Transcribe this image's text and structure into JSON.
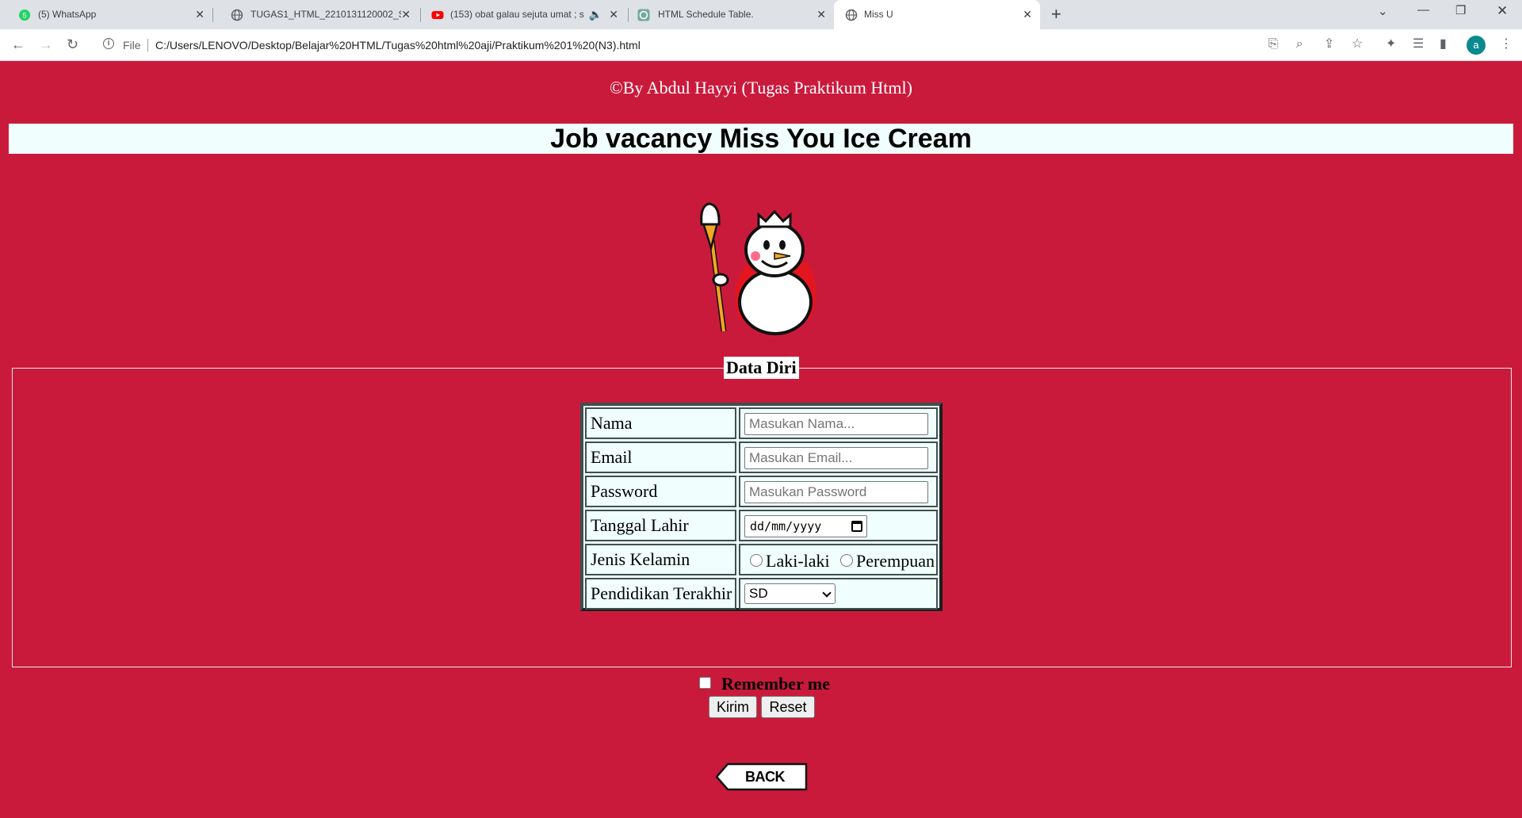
{
  "browser": {
    "tabs": [
      {
        "title": "(5) WhatsApp",
        "icon": "whatsapp-icon"
      },
      {
        "title": "TUGAS1_HTML_2210131120002_SIT",
        "icon": "globe-icon"
      },
      {
        "title": "(153) obat galau sejuta umat ; s",
        "icon": "youtube-icon"
      },
      {
        "title": "HTML Schedule Table.",
        "icon": "chatgpt-icon"
      },
      {
        "title": "Miss U",
        "icon": "globe-icon"
      }
    ],
    "address": {
      "scheme": "File",
      "url": "C:/Users/LENOVO/Desktop/Belajar%20HTML/Tugas%20html%20aji/Praktikum%201%20(N3).html"
    },
    "profile_initial": "a"
  },
  "page": {
    "credit": "©By Abdul Hayyi (Tugas Praktikum Html)",
    "heading": "Job vacancy Miss You Ice Cream",
    "legend": "Data Diri",
    "form": {
      "name_label": "Nama",
      "name_placeholder": "Masukan Nama...",
      "email_label": "Email",
      "email_placeholder": "Masukan Email...",
      "password_label": "Password",
      "password_placeholder": "Masukan Password",
      "dob_label": "Tanggal Lahir",
      "dob_placeholder": "dd/mm/yyyy",
      "gender_label": "Jenis Kelamin",
      "gender_options": [
        "Laki-laki",
        "Perempuan"
      ],
      "education_label": "Pendidikan Terakhir",
      "education_selected": "SD"
    },
    "remember_label": "Remember me",
    "submit_label": "Kirim",
    "reset_label": "Reset",
    "back_label": "BACK"
  },
  "colors": {
    "page_background": "#ca1a3c",
    "heading_background": "#f0fffe",
    "table_border": "#3d4f4f"
  }
}
